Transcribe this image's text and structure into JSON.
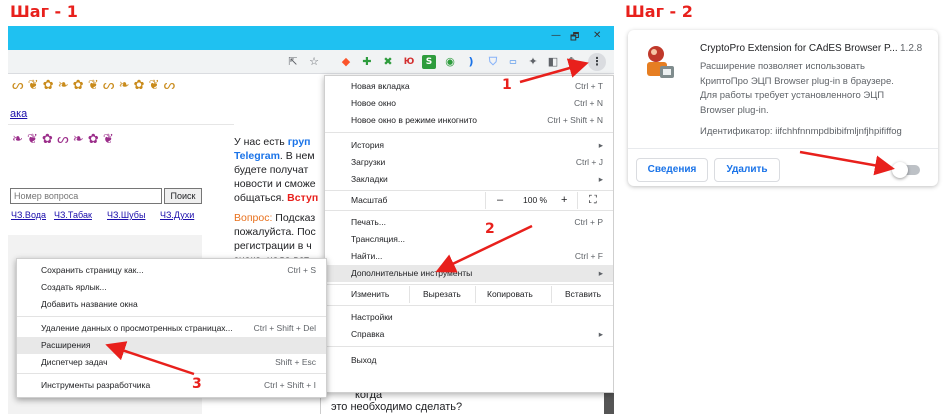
{
  "steps": {
    "step1": "Шаг - 1",
    "step2": "Шаг - 2"
  },
  "markers": {
    "m1": "1",
    "m2": "2",
    "m3": "3"
  },
  "colors": {
    "accent": "#e8201c",
    "titlebar": "#1fc1f1",
    "link": "#1a0dab",
    "blue": "#1a73e8"
  },
  "window": {
    "minimize": "—",
    "maximize": "🗗",
    "close": "✕"
  },
  "toolbar": {
    "share_icon": "share-icon",
    "star_icon": "star-icon",
    "menu_icon": "three-dot-menu-icon"
  },
  "site": {
    "link_top": "ака",
    "search_placeholder": "Номер вопроса",
    "search_button": "Поиск",
    "nav": [
      "ЧЗ.Вода",
      "ЧЗ.Табак",
      "ЧЗ.Шубы",
      "ЧЗ.Духи"
    ],
    "text": {
      "p1a": "У нас есть ",
      "p1b": "груп",
      "p1c": "Telegram",
      "p1d": ". В нем",
      "p1e": "будете получат",
      "p1f": "новости и сможе",
      "p1g": "общаться. ",
      "p1h": "Вступ",
      "q_label": "Вопрос:",
      "q1": " Подсказ",
      "q2": "пожалуйста. Пос",
      "q3": "регистрации в ч",
      "q4": "знаке, надо вст",
      "b1": "когда",
      "b2": "это необходимо сделать?"
    }
  },
  "menu": {
    "items": [
      {
        "label": "Новая вкладка",
        "shortcut": "Ctrl + T"
      },
      {
        "label": "Новое окно",
        "shortcut": "Ctrl + N"
      },
      {
        "label": "Новое окно в режиме инкогнито",
        "shortcut": "Ctrl + Shift + N"
      },
      {
        "label": "История",
        "shortcut": "▸"
      },
      {
        "label": "Загрузки",
        "shortcut": "Ctrl + J"
      },
      {
        "label": "Закладки",
        "shortcut": "▸"
      },
      {
        "label": "Печать...",
        "shortcut": "Ctrl + P"
      },
      {
        "label": "Трансляция...",
        "shortcut": ""
      },
      {
        "label": "Найти...",
        "shortcut": "Ctrl + F"
      },
      {
        "label": "Дополнительные инструменты",
        "shortcut": "▸"
      },
      {
        "label": "Настройки",
        "shortcut": ""
      },
      {
        "label": "Справка",
        "shortcut": "▸"
      },
      {
        "label": "Выход",
        "shortcut": ""
      }
    ],
    "zoom": {
      "label": "Масштаб",
      "minus": "–",
      "value": "100 %",
      "plus": "+",
      "fullscreen": "⛶"
    },
    "edit": {
      "label": "Изменить",
      "cut": "Вырезать",
      "copy": "Копировать",
      "paste": "Вставить"
    }
  },
  "submenu": {
    "items": [
      {
        "label": "Сохранить страницу как...",
        "shortcut": "Ctrl + S"
      },
      {
        "label": "Создать ярлык...",
        "shortcut": ""
      },
      {
        "label": "Добавить название окна",
        "shortcut": ""
      },
      {
        "label": "Удаление данных о просмотренных страницах...",
        "shortcut": "Ctrl + Shift + Del"
      },
      {
        "label": "Расширения",
        "shortcut": ""
      },
      {
        "label": "Диспетчер задач",
        "shortcut": "Shift + Esc"
      },
      {
        "label": "Инструменты разработчика",
        "shortcut": "Ctrl + Shift + I"
      }
    ]
  },
  "extension": {
    "title": "CryptoPro Extension for CAdES Browser P...",
    "version": "1.2.8",
    "desc": [
      "Расширение позволяет использовать",
      "КриптоПро ЭЦП Browser plug-in в браузере.",
      "Для работы требует установленного ЭЦП",
      "Browser plug-in."
    ],
    "id_label": "Идентификатор: iifchhfnnmpdbibifmljnfjhpififfog",
    "details_button": "Сведения",
    "remove_button": "Удалить",
    "toggle_on": false
  }
}
